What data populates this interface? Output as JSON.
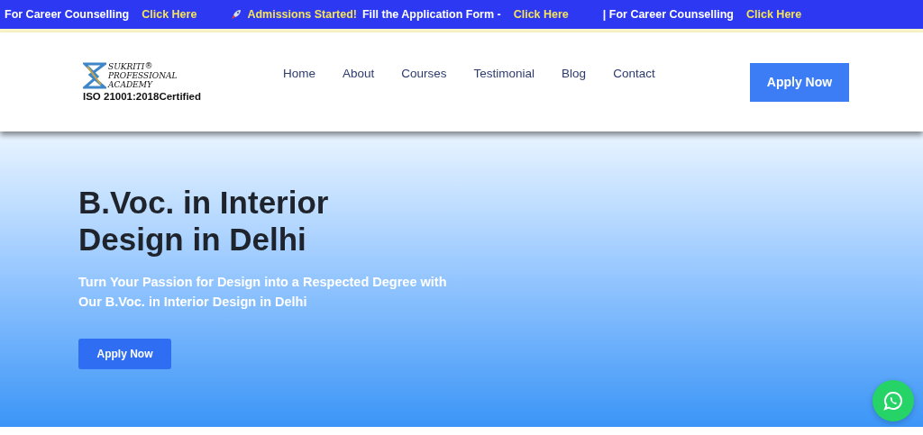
{
  "ticker": [
    {
      "rocket": false,
      "text": "For Career Counselling",
      "link": "Click Here"
    },
    {
      "rocket": true,
      "highlight": "Admissions Started!",
      "text": "Fill the Application Form -",
      "link": "Click Here"
    },
    {
      "rocket": false,
      "text": "| For Career Counselling",
      "link": "Click Here"
    }
  ],
  "logo": {
    "line1": "SUKRITI",
    "mark": "®",
    "line2": "PROFESSIONAL",
    "line3": "ACADEMY",
    "certification": "ISO 21001:2018Certified"
  },
  "nav": [
    {
      "label": "Home"
    },
    {
      "label": "About"
    },
    {
      "label": "Courses"
    },
    {
      "label": "Testimonial"
    },
    {
      "label": "Blog"
    },
    {
      "label": "Contact"
    }
  ],
  "header_button": "Apply Now",
  "hero": {
    "title": "B.Voc. in Interior Design in Delhi",
    "subtitle": "Turn Your Passion for Design into a Respected Degree with Our B.Voc. in Interior Design in Delhi",
    "button": "Apply Now"
  }
}
